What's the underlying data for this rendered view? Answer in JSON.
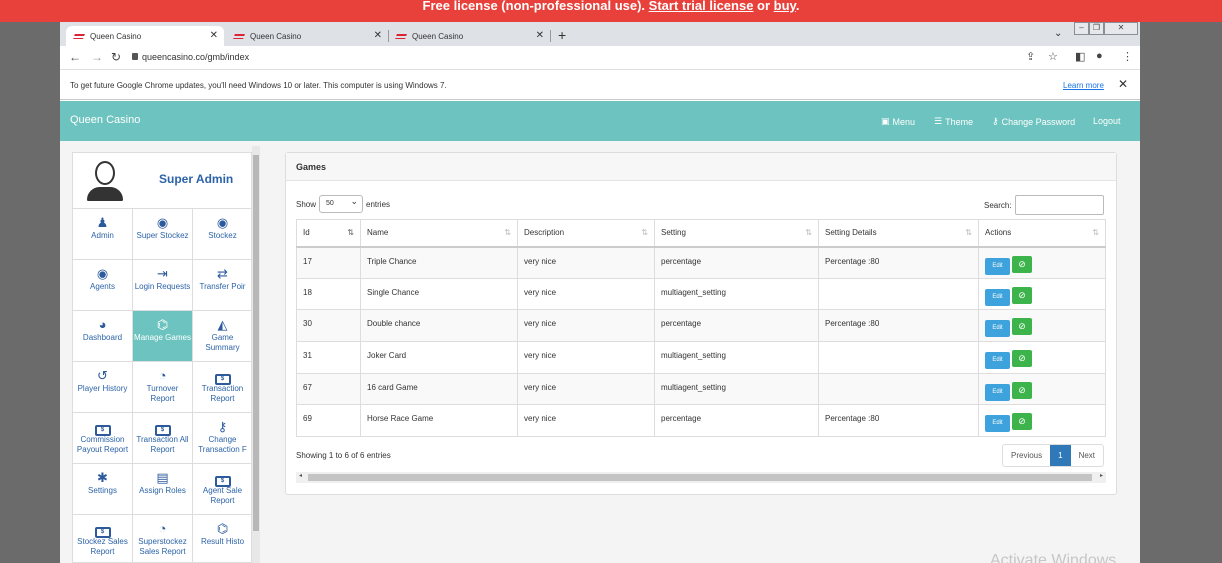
{
  "license": {
    "prefix": "Free license (non-professional use). ",
    "trial_link": "Start trial license",
    "middle": " or ",
    "buy_link": "buy",
    "suffix": "."
  },
  "browser": {
    "tabs": [
      {
        "title": "Queen Casino"
      },
      {
        "title": "Queen Casino"
      },
      {
        "title": "Queen Casino"
      }
    ],
    "url": "queencasino.co/gmb/index",
    "info_message": "To get future Google Chrome updates, you'll need Windows 10 or later. This computer is using Windows 7.",
    "learn_more": "Learn more"
  },
  "app": {
    "brand": "Queen Casino",
    "nav": {
      "menu": "Menu",
      "theme": "Theme",
      "change_password": "Change Password",
      "logout": "Logout"
    }
  },
  "sidebar": {
    "user_name": "Super Admin",
    "items": [
      {
        "label": "Admin",
        "icon": "admin-icon"
      },
      {
        "label": "Super Stockez",
        "icon": "user-circle-icon"
      },
      {
        "label": "Stockez",
        "icon": "user-circle-icon"
      },
      {
        "label": "Agents",
        "icon": "user-circle-icon"
      },
      {
        "label": "Login Requests",
        "icon": "login-icon"
      },
      {
        "label": "Transfer Poir",
        "icon": "transfer-icon"
      },
      {
        "label": "Dashboard",
        "icon": "dashboard-icon"
      },
      {
        "label": "Manage Games",
        "icon": "gamepad-icon"
      },
      {
        "label": "Game Summary",
        "icon": "area-chart-icon"
      },
      {
        "label": "Player History",
        "icon": "history-icon"
      },
      {
        "label": "Turnover Report",
        "icon": "pie-chart-icon"
      },
      {
        "label": "Transaction Report",
        "icon": "money-icon"
      },
      {
        "label": "Commission Payout Report",
        "icon": "money-icon"
      },
      {
        "label": "Transaction All Report",
        "icon": "money-icon"
      },
      {
        "label": "Change Transaction F",
        "icon": "key-icon"
      },
      {
        "label": "Settings",
        "icon": "gear-icon"
      },
      {
        "label": "Assign Roles",
        "icon": "id-card-icon"
      },
      {
        "label": "Agent Sale Report",
        "icon": "money-icon"
      },
      {
        "label": "Stockez Sales Report",
        "icon": "money-icon"
      },
      {
        "label": "Superstockez Sales Report",
        "icon": "pie-chart-icon"
      },
      {
        "label": "Result Histo",
        "icon": "gamepad-icon"
      }
    ]
  },
  "games": {
    "title": "Games",
    "show_label": "Show",
    "entries_value": "50",
    "entries_label": "entries",
    "search_label": "Search:",
    "columns": [
      "Id",
      "Name",
      "Description",
      "Setting",
      "Setting Details",
      "Actions"
    ],
    "rows": [
      {
        "id": "17",
        "name": "Triple Chance",
        "description": "very nice",
        "setting": "percentage",
        "details": "Percentage :80"
      },
      {
        "id": "18",
        "name": "Single Chance",
        "description": "very nice",
        "setting": "multiagent_setting",
        "details": ""
      },
      {
        "id": "30",
        "name": "Double chance",
        "description": "very nice",
        "setting": "percentage",
        "details": "Percentage :80"
      },
      {
        "id": "31",
        "name": "Joker Card",
        "description": "very nice",
        "setting": "multiagent_setting",
        "details": ""
      },
      {
        "id": "67",
        "name": "16 card Game",
        "description": "very nice",
        "setting": "multiagent_setting",
        "details": ""
      },
      {
        "id": "69",
        "name": "Horse Race Game",
        "description": "very nice",
        "setting": "percentage",
        "details": "Percentage :80"
      }
    ],
    "edit_label": "Edit",
    "showing_text": "Showing 1 to 6 of 6 entries",
    "pager": {
      "previous": "Previous",
      "current": "1",
      "next": "Next"
    }
  },
  "watermark": "Activate Windows"
}
